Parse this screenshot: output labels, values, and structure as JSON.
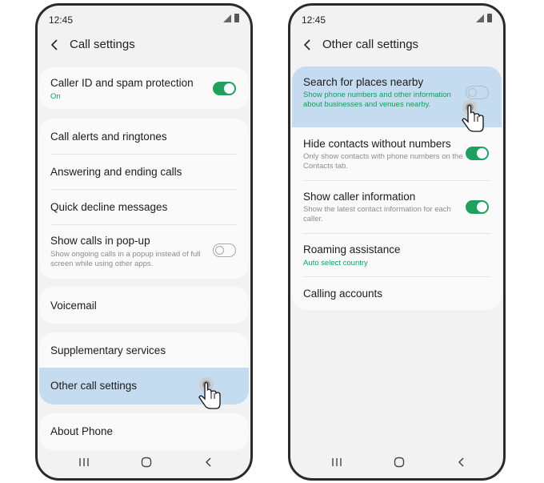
{
  "left_screen": {
    "status_time": "12:45",
    "title": "Call settings",
    "caller_id": {
      "label": "Caller ID and spam protection",
      "status": "On",
      "toggle_on": true
    },
    "alerts": "Call alerts and ringtones",
    "answering": "Answering and ending calls",
    "quick_decline": "Quick decline messages",
    "popup": {
      "label": "Show calls in pop-up",
      "desc": "Show ongoing calls in a popup instead of full screen while using other apps.",
      "toggle_on": false
    },
    "voicemail": "Voicemail",
    "supplementary": "Supplementary services",
    "other": "Other call settings",
    "about": "About Phone"
  },
  "right_screen": {
    "status_time": "12:45",
    "title": "Other call settings",
    "search_places": {
      "label": "Search for places nearby",
      "desc": "Show phone numbers and other information about businesses and venues nearby.",
      "toggle_on": false
    },
    "hide_contacts": {
      "label": "Hide contacts without numbers",
      "desc": "Only show contacts with phone numbers on the Contacts tab.",
      "toggle_on": true
    },
    "caller_info": {
      "label": "Show caller information",
      "desc": "Show the latest contact information for each caller.",
      "toggle_on": true
    },
    "roaming": {
      "label": "Roaming assistance",
      "status": "Auto select country"
    },
    "calling_accounts": "Calling accounts"
  },
  "colors": {
    "accent_green": "#1fa05c",
    "highlight_blue": "#c5dbef",
    "frame": "#2b2b2b"
  }
}
